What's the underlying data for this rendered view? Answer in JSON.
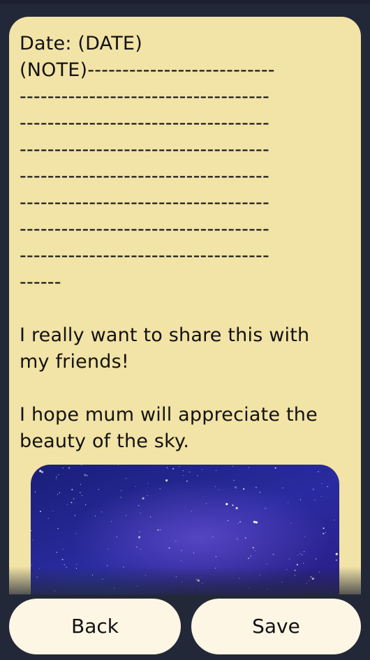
{
  "note": {
    "date_line": "Date: (DATE)",
    "note_line": "(NOTE)---------------------------",
    "dash_lines": [
      "------------------------------------",
      "------------------------------------",
      "------------------------------------",
      "------------------------------------",
      "------------------------------------",
      "------------------------------------",
      "------------------------------------",
      "------"
    ],
    "paragraph_1": [
      "I really want to share this with",
      "my friends!"
    ],
    "paragraph_2": [
      "I hope mum will appreciate the",
      "beauty of the sky."
    ]
  },
  "image": {
    "subject": "starry night sky",
    "colors": {
      "deep": "#1a1e78",
      "mid": "#2a2ba0",
      "glow": "#785adc"
    }
  },
  "buttons": {
    "back_label": "Back",
    "save_label": "Save"
  },
  "colors": {
    "background": "#232838",
    "note_paper": "#f2e3a6",
    "button_fill": "#fdf6e5",
    "text": "#121212"
  }
}
